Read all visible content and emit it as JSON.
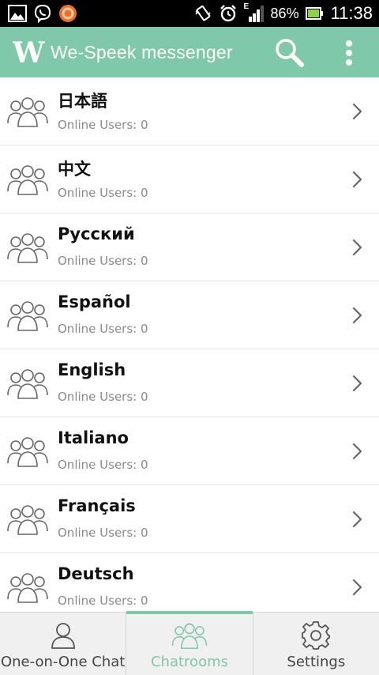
{
  "status_bar": {
    "battery_percent": "86%",
    "time": "11:38",
    "network_type": "E",
    "icons_left": [
      "gallery-icon",
      "viber-icon",
      "app-notification-icon"
    ],
    "icons_right": [
      "vibrate-icon",
      "alarm-icon",
      "signal-icon",
      "battery-icon"
    ]
  },
  "app_bar": {
    "logo_letter": "W",
    "title": "We-Speek messenger",
    "background_color": "#7fc8a9",
    "icons": [
      "search-icon",
      "overflow-menu-icon"
    ]
  },
  "rooms": [
    {
      "name": "日本語",
      "users_label": "Online Users:",
      "users_count": "0"
    },
    {
      "name": "中文",
      "users_label": "Online Users:",
      "users_count": "0"
    },
    {
      "name": "Русский",
      "users_label": "Online Users:",
      "users_count": "0"
    },
    {
      "name": "Español",
      "users_label": "Online Users:",
      "users_count": "0"
    },
    {
      "name": "English",
      "users_label": "Online Users:",
      "users_count": "0"
    },
    {
      "name": "Italiano",
      "users_label": "Online Users:",
      "users_count": "0"
    },
    {
      "name": "Français",
      "users_label": "Online Users:",
      "users_count": "0"
    },
    {
      "name": "Deutsch",
      "users_label": "Online Users:",
      "users_count": "0"
    }
  ],
  "bottom_nav": {
    "tabs": [
      {
        "label": "One-on-One Chat",
        "icon": "person-icon",
        "active": false
      },
      {
        "label": "Chatrooms",
        "icon": "group-icon",
        "active": true
      },
      {
        "label": "Settings",
        "icon": "gear-icon",
        "active": false
      }
    ],
    "active_color": "#7fc8a9"
  }
}
